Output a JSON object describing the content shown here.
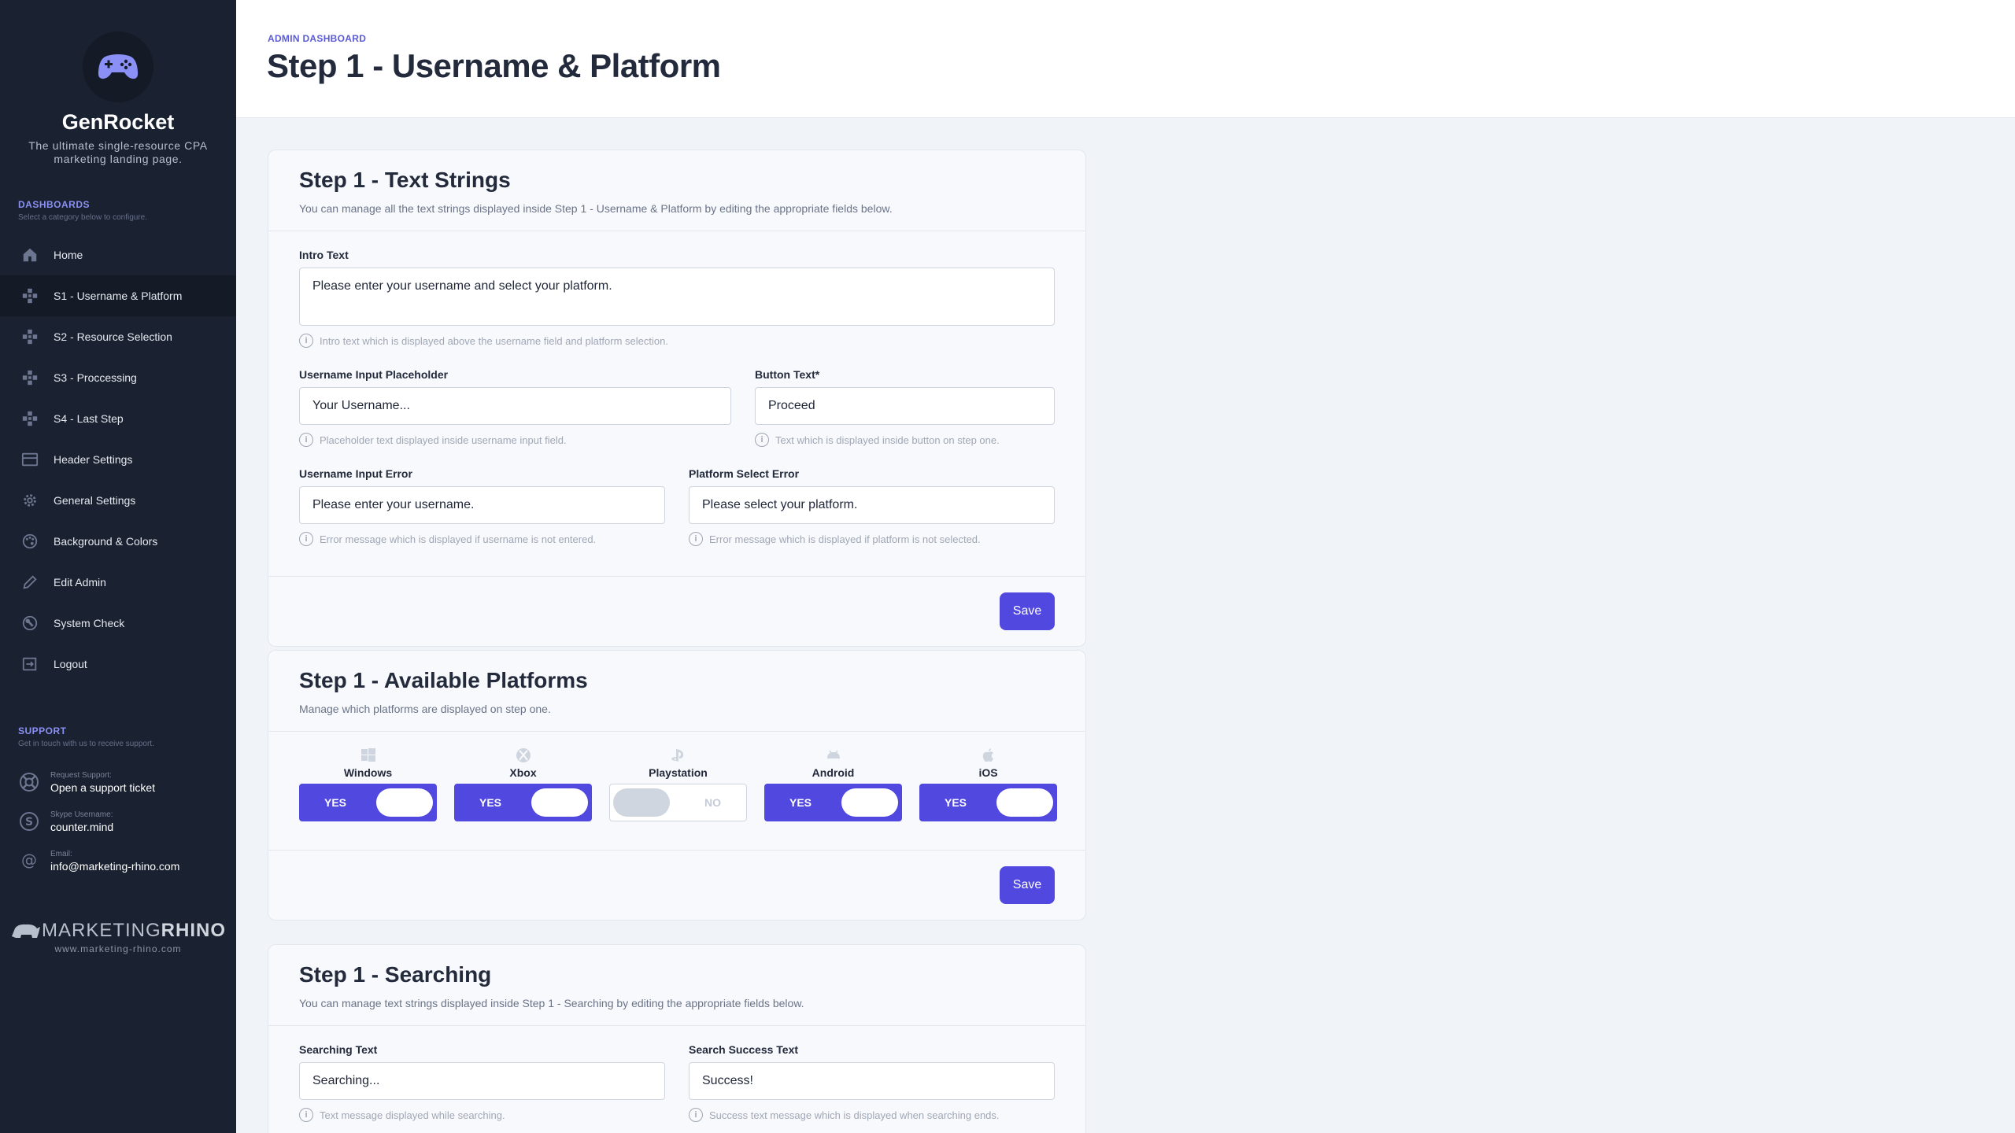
{
  "brand": {
    "name": "GenRocket",
    "tagline": "The ultimate single-resource CPA marketing landing page."
  },
  "sidebar": {
    "dashboards_title": "DASHBOARDS",
    "dashboards_sub": "Select a category below to configure.",
    "items": [
      {
        "label": "Home",
        "icon": "home-icon"
      },
      {
        "label": "S1 - Username & Platform",
        "icon": "gamepad-icon",
        "active": true
      },
      {
        "label": "S2 - Resource Selection",
        "icon": "gamepad-icon"
      },
      {
        "label": "S3 - Proccessing",
        "icon": "gamepad-icon"
      },
      {
        "label": "S4 - Last Step",
        "icon": "gamepad-icon"
      },
      {
        "label": "Header Settings",
        "icon": "header-icon"
      },
      {
        "label": "General Settings",
        "icon": "gear-icon"
      },
      {
        "label": "Background & Colors",
        "icon": "palette-icon"
      },
      {
        "label": "Edit Admin",
        "icon": "pencil-icon"
      },
      {
        "label": "System Check",
        "icon": "wrench-icon"
      },
      {
        "label": "Logout",
        "icon": "logout-icon"
      }
    ],
    "support_title": "SUPPORT",
    "support_sub": "Get in touch with us to receive support.",
    "support": [
      {
        "label": "Request Support:",
        "value": "Open a support ticket",
        "icon": "lifebuoy-icon"
      },
      {
        "label": "Skype Username:",
        "value": "counter.mind",
        "icon": "skype-icon"
      },
      {
        "label": "Email:",
        "value": "info@marketing-rhino.com",
        "icon": "at-icon"
      }
    ],
    "footer_logo_a": "MARKETING",
    "footer_logo_b": "RHINO",
    "footer_url": "www.marketing-rhino.com"
  },
  "header": {
    "breadcrumb": "ADMIN DASHBOARD",
    "title": "Step 1 - Username & Platform"
  },
  "text_strings": {
    "title": "Step 1 - Text Strings",
    "desc": "You can manage all the text strings displayed inside Step 1 - Username & Platform by editing the appropriate fields below.",
    "intro_label": "Intro Text",
    "intro_value": "Please enter your username and select your platform.",
    "intro_help": "Intro text which is displayed above the username field and platform selection.",
    "placeholder_label": "Username Input Placeholder",
    "placeholder_value": "Your Username...",
    "placeholder_help": "Placeholder text displayed inside username input field.",
    "button_label": "Button Text*",
    "button_value": "Proceed",
    "button_help": "Text which is displayed inside button on step one.",
    "user_error_label": "Username Input Error",
    "user_error_value": "Please enter your username.",
    "user_error_help": "Error message which is displayed if username is not entered.",
    "platform_error_label": "Platform Select Error",
    "platform_error_value": "Please select your platform.",
    "platform_error_help": "Error message which is displayed if platform is not selected.",
    "save": "Save"
  },
  "platforms": {
    "title": "Step 1 - Available Platforms",
    "desc": "Manage which platforms are displayed on step one.",
    "items": [
      {
        "name": "Windows",
        "icon": "windows-icon",
        "enabled": true,
        "yes": "YES"
      },
      {
        "name": "Xbox",
        "icon": "xbox-icon",
        "enabled": true,
        "yes": "YES"
      },
      {
        "name": "Playstation",
        "icon": "playstation-icon",
        "enabled": false,
        "no": "NO"
      },
      {
        "name": "Android",
        "icon": "android-icon",
        "enabled": true,
        "yes": "YES"
      },
      {
        "name": "iOS",
        "icon": "apple-icon",
        "enabled": true,
        "yes": "YES"
      }
    ],
    "save": "Save"
  },
  "searching": {
    "title": "Step 1 - Searching",
    "desc": "You can manage text strings displayed inside Step 1 - Searching by editing the appropriate fields below.",
    "search_label": "Searching Text",
    "search_value": "Searching...",
    "search_help": "Text message displayed while searching.",
    "success_label": "Search Success Text",
    "success_value": "Success!",
    "success_help": "Success text message which is displayed when searching ends."
  },
  "colors": {
    "accent": "#5148e0",
    "sidebar_bg": "#1a2130"
  }
}
